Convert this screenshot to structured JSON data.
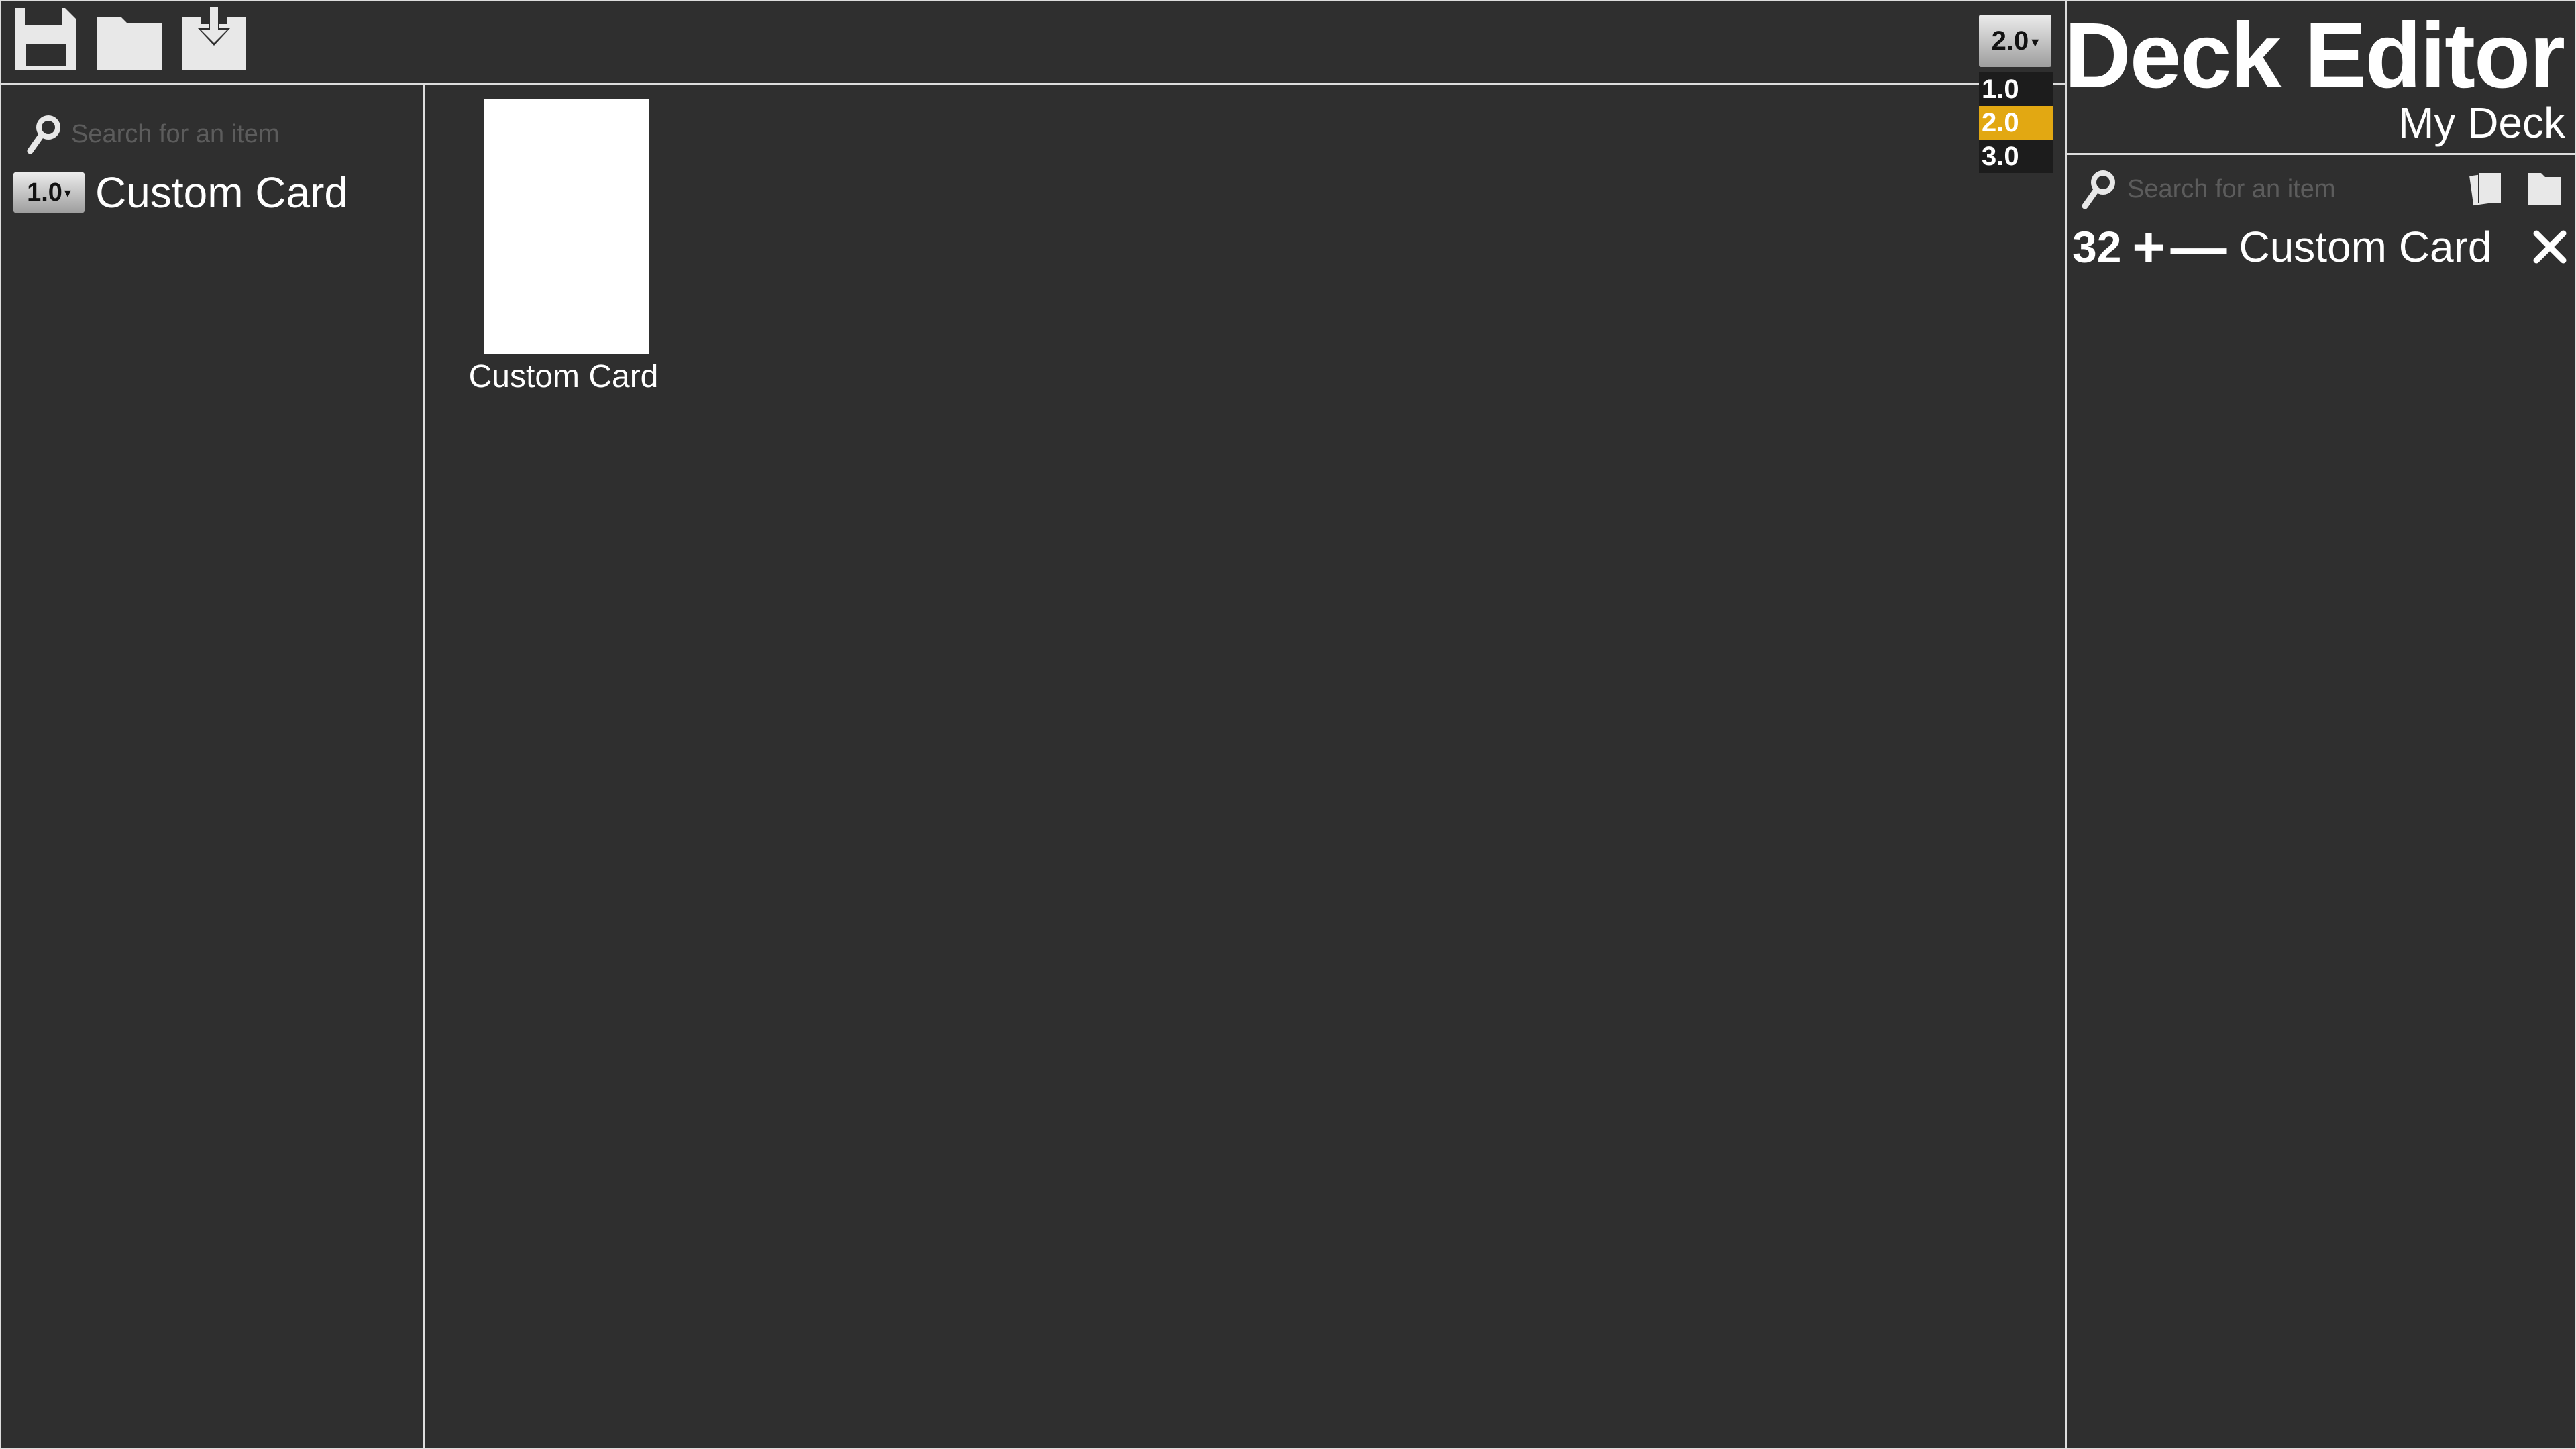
{
  "toolbar": {
    "icons": [
      "save-icon",
      "folder-icon",
      "import-icon"
    ]
  },
  "version_dropdown": {
    "current": "2.0",
    "options": [
      "1.0",
      "2.0",
      "3.0"
    ],
    "selected": "2.0",
    "highlight_color": "#e2a812"
  },
  "left_panel": {
    "search": {
      "placeholder": "Search for an item",
      "value": ""
    },
    "items": [
      {
        "version": "1.0",
        "label": "Custom Card"
      }
    ]
  },
  "main": {
    "cards": [
      {
        "label": "Custom Card"
      }
    ]
  },
  "deck": {
    "title": "Deck Editor",
    "name": "My Deck",
    "search": {
      "placeholder": "Search for an item",
      "value": ""
    },
    "tools": [
      "cards-icon",
      "folder-icon"
    ],
    "items": [
      {
        "count": "32",
        "add_label": "+",
        "remove_label": "—",
        "label": "Custom Card"
      }
    ]
  },
  "colors": {
    "background": "#2f2f2f",
    "border": "#dddddd",
    "text": "#ffffff"
  }
}
